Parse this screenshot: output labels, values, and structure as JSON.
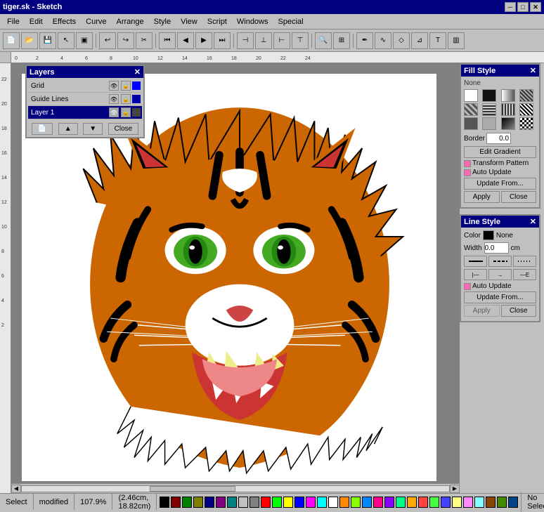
{
  "titlebar": {
    "title": "tiger.sk - Sketch",
    "close": "✕",
    "minimize": "─",
    "maximize": "□"
  },
  "menubar": {
    "items": [
      "File",
      "Edit",
      "Effects",
      "Curve",
      "Arrange",
      "Style",
      "View",
      "Script",
      "Windows",
      "Special"
    ]
  },
  "layers": {
    "title": "Layers",
    "rows": [
      {
        "name": "Grid",
        "selected": false
      },
      {
        "name": "Guide Lines",
        "selected": false
      },
      {
        "name": "Layer 1",
        "selected": true
      }
    ],
    "buttons": [
      "▲",
      "▼",
      "Close"
    ]
  },
  "fill_style": {
    "title": "Fill Style",
    "none_label": "None",
    "border_label": "Border",
    "border_value": "0.0",
    "edit_gradient": "Edit Gradient",
    "transform_pattern": "Transform Pattern",
    "auto_update": "Auto Update",
    "update_from": "Update From...",
    "apply": "Apply",
    "close": "Close"
  },
  "line_style": {
    "title": "Line Style",
    "color_label": "Color",
    "none_label": "None",
    "width_label": "Width",
    "width_value": "0.0",
    "unit": "cm",
    "auto_update": "Auto Update",
    "update_from": "Update From...",
    "apply": "Apply",
    "close": "Close"
  },
  "statusbar": {
    "tool": "Select",
    "state": "modified",
    "zoom": "107.9%",
    "coords": "(2.46cm, 18.82cm)",
    "selection": "No Selection",
    "scroll_right": "▶",
    "scroll_left": "◀"
  },
  "colors": [
    "#000000",
    "#800000",
    "#008000",
    "#808000",
    "#000080",
    "#800080",
    "#008080",
    "#c0c0c0",
    "#808080",
    "#ff0000",
    "#00ff00",
    "#ffff00",
    "#0000ff",
    "#ff00ff",
    "#00ffff",
    "#ffffff",
    "#ff8800",
    "#88ff00",
    "#0088ff",
    "#ff0088",
    "#8800ff",
    "#00ff88",
    "#ffaa00",
    "#ff4444",
    "#44ff44",
    "#4444ff",
    "#ffff88",
    "#ff88ff",
    "#88ffff",
    "#884400",
    "#448800",
    "#004488"
  ]
}
